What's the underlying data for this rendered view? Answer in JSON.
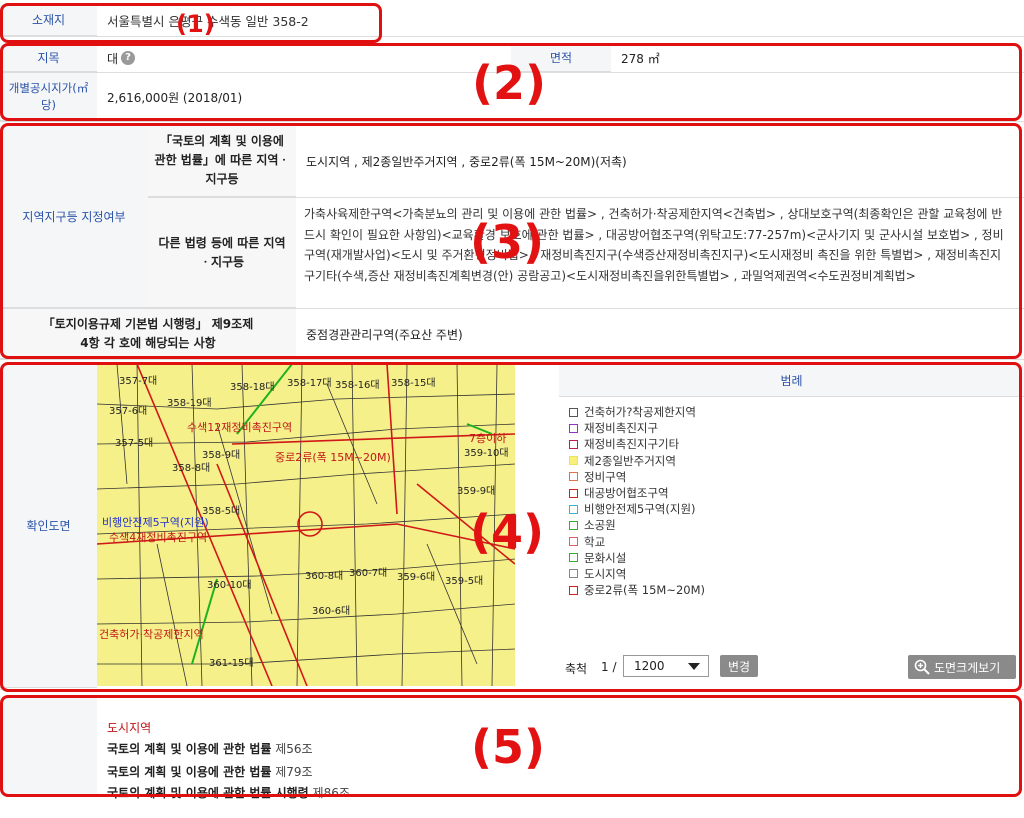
{
  "location": {
    "label": "소재지",
    "address": "서울특별시 은평구 수색동 일반 358-2"
  },
  "land": {
    "category_label": "지목",
    "category_value": "대",
    "area_label": "면적",
    "area_value": "278 ㎡",
    "price_label": "개별공시지가(㎡당)",
    "price_value": "2,616,000원 (2018/01)"
  },
  "zoning": {
    "section_label": "지역지구등 지정여부",
    "national_label": "「국토의 계획 및 이용에 관한 법률」에 따른 지역ㆍ지구등",
    "national_value": "도시지역 , 제2종일반주거지역 , 중로2류(폭 15M~20M)(저촉)",
    "other_label": "다른 법령 등에 따른 지역ㆍ지구등",
    "other_value": "가축사육제한구역<가축분뇨의 관리 및 이용에 관한 법률> , 건축허가·착공제한지역<건축법> , 상대보호구역(최종확인은 관할 교육청에 반드시 확인이 필요한 사항임)<교육환경 보호에 관한 법률> , 대공방어협조구역(위탁고도:77-257m)<군사기지 및 군사시설 보호법> , 정비구역(재개발사업)<도시 및 주거환경정비법> , 재정비촉진지구(수색증산재정비촉진지구)<도시재정비 촉진을 위한 특별법> , 재정비촉진지구기타(수색,증산 재정비촉진계획변경(안) 공람공고)<도시재정비촉진을위한특별법> , 과밀억제권역<수도권정비계획법>",
    "enforcement_label": "「토지이용규제 기본법 시행령」 제9조제4항 각 호에 해당되는 사항",
    "enforcement_value": "중점경관관리구역(주요산 주변)"
  },
  "map": {
    "section_label": "확인도면",
    "legend_title": "범례",
    "legend": [
      {
        "label": "건축허가?착공제한지역",
        "color": "#ffffff"
      },
      {
        "label": "재정비촉진지구",
        "color": "#ffffff"
      },
      {
        "label": "재정비촉진지구기타",
        "color": "#ffffff"
      },
      {
        "label": "제2종일반주거지역",
        "color": "#f7f07a"
      },
      {
        "label": "정비구역",
        "color": "#ffffff"
      },
      {
        "label": "대공방어협조구역",
        "color": "#ffffff"
      },
      {
        "label": "비행안전제5구역(지원)",
        "color": "#ffffff"
      },
      {
        "label": "소공원",
        "color": "#ffffff"
      },
      {
        "label": "학교",
        "color": "#ffffff"
      },
      {
        "label": "문화시설",
        "color": "#ffffff"
      },
      {
        "label": "도시지역",
        "color": "#ffffff"
      },
      {
        "label": "중로2류(폭 15M~20M)",
        "color": "#ffffff"
      }
    ],
    "legend_borders": [
      "#555555",
      "#9b30c8",
      "#c0184f",
      "#f0e060",
      "#e07050",
      "#d02020",
      "#30b8d8",
      "#30b030",
      "#e06060",
      "#30b030",
      "#888888",
      "#d02020"
    ],
    "scale_label": "축척",
    "scale_prefix": "1 /",
    "scale_value": "1200",
    "change_button": "변경",
    "enlarge_button": "도면크게보기",
    "map_labels": [
      "357-7대",
      "358-18대",
      "358-17대",
      "358-16대",
      "358-15대",
      "357-6대",
      "358-19대",
      "357-5대",
      "358-8대",
      "358-9대",
      "수색12재정비촉진구역",
      "중로2류(폭 15M~20M)",
      "7층이하",
      "359-10대",
      "359-9대",
      "358-5대",
      "비행안전제5구역(지원)",
      "수색4재정비촉진구역",
      "360-10대",
      "360-8대",
      "360-7대",
      "359-6대",
      "359-5대",
      "360-6대",
      "건축허가·착공제한지역",
      "361-15대"
    ]
  },
  "laws": {
    "title": "도시지역",
    "items": [
      {
        "name": "국토의 계획 및 이용에 관한 법률",
        "article": "제56조"
      },
      {
        "name": "국토의 계획 및 이용에 관한 법률",
        "article": "제79조"
      },
      {
        "name": "국토의 계획 및 이용에 관한 법률 시행령",
        "article": "제86조"
      }
    ]
  },
  "callouts": [
    "(1)",
    "(2)",
    "(3)",
    "(4)",
    "(5)"
  ]
}
